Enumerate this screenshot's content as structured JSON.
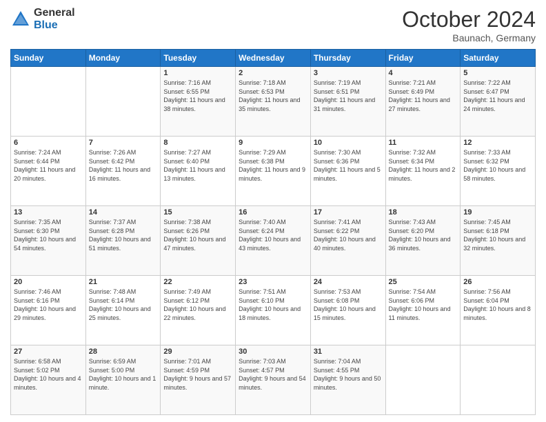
{
  "header": {
    "logo_general": "General",
    "logo_blue": "Blue",
    "month_title": "October 2024",
    "subtitle": "Baunach, Germany"
  },
  "weekdays": [
    "Sunday",
    "Monday",
    "Tuesday",
    "Wednesday",
    "Thursday",
    "Friday",
    "Saturday"
  ],
  "weeks": [
    [
      {
        "day": "",
        "sunrise": "",
        "sunset": "",
        "daylight": ""
      },
      {
        "day": "",
        "sunrise": "",
        "sunset": "",
        "daylight": ""
      },
      {
        "day": "1",
        "sunrise": "Sunrise: 7:16 AM",
        "sunset": "Sunset: 6:55 PM",
        "daylight": "Daylight: 11 hours and 38 minutes."
      },
      {
        "day": "2",
        "sunrise": "Sunrise: 7:18 AM",
        "sunset": "Sunset: 6:53 PM",
        "daylight": "Daylight: 11 hours and 35 minutes."
      },
      {
        "day": "3",
        "sunrise": "Sunrise: 7:19 AM",
        "sunset": "Sunset: 6:51 PM",
        "daylight": "Daylight: 11 hours and 31 minutes."
      },
      {
        "day": "4",
        "sunrise": "Sunrise: 7:21 AM",
        "sunset": "Sunset: 6:49 PM",
        "daylight": "Daylight: 11 hours and 27 minutes."
      },
      {
        "day": "5",
        "sunrise": "Sunrise: 7:22 AM",
        "sunset": "Sunset: 6:47 PM",
        "daylight": "Daylight: 11 hours and 24 minutes."
      }
    ],
    [
      {
        "day": "6",
        "sunrise": "Sunrise: 7:24 AM",
        "sunset": "Sunset: 6:44 PM",
        "daylight": "Daylight: 11 hours and 20 minutes."
      },
      {
        "day": "7",
        "sunrise": "Sunrise: 7:26 AM",
        "sunset": "Sunset: 6:42 PM",
        "daylight": "Daylight: 11 hours and 16 minutes."
      },
      {
        "day": "8",
        "sunrise": "Sunrise: 7:27 AM",
        "sunset": "Sunset: 6:40 PM",
        "daylight": "Daylight: 11 hours and 13 minutes."
      },
      {
        "day": "9",
        "sunrise": "Sunrise: 7:29 AM",
        "sunset": "Sunset: 6:38 PM",
        "daylight": "Daylight: 11 hours and 9 minutes."
      },
      {
        "day": "10",
        "sunrise": "Sunrise: 7:30 AM",
        "sunset": "Sunset: 6:36 PM",
        "daylight": "Daylight: 11 hours and 5 minutes."
      },
      {
        "day": "11",
        "sunrise": "Sunrise: 7:32 AM",
        "sunset": "Sunset: 6:34 PM",
        "daylight": "Daylight: 11 hours and 2 minutes."
      },
      {
        "day": "12",
        "sunrise": "Sunrise: 7:33 AM",
        "sunset": "Sunset: 6:32 PM",
        "daylight": "Daylight: 10 hours and 58 minutes."
      }
    ],
    [
      {
        "day": "13",
        "sunrise": "Sunrise: 7:35 AM",
        "sunset": "Sunset: 6:30 PM",
        "daylight": "Daylight: 10 hours and 54 minutes."
      },
      {
        "day": "14",
        "sunrise": "Sunrise: 7:37 AM",
        "sunset": "Sunset: 6:28 PM",
        "daylight": "Daylight: 10 hours and 51 minutes."
      },
      {
        "day": "15",
        "sunrise": "Sunrise: 7:38 AM",
        "sunset": "Sunset: 6:26 PM",
        "daylight": "Daylight: 10 hours and 47 minutes."
      },
      {
        "day": "16",
        "sunrise": "Sunrise: 7:40 AM",
        "sunset": "Sunset: 6:24 PM",
        "daylight": "Daylight: 10 hours and 43 minutes."
      },
      {
        "day": "17",
        "sunrise": "Sunrise: 7:41 AM",
        "sunset": "Sunset: 6:22 PM",
        "daylight": "Daylight: 10 hours and 40 minutes."
      },
      {
        "day": "18",
        "sunrise": "Sunrise: 7:43 AM",
        "sunset": "Sunset: 6:20 PM",
        "daylight": "Daylight: 10 hours and 36 minutes."
      },
      {
        "day": "19",
        "sunrise": "Sunrise: 7:45 AM",
        "sunset": "Sunset: 6:18 PM",
        "daylight": "Daylight: 10 hours and 32 minutes."
      }
    ],
    [
      {
        "day": "20",
        "sunrise": "Sunrise: 7:46 AM",
        "sunset": "Sunset: 6:16 PM",
        "daylight": "Daylight: 10 hours and 29 minutes."
      },
      {
        "day": "21",
        "sunrise": "Sunrise: 7:48 AM",
        "sunset": "Sunset: 6:14 PM",
        "daylight": "Daylight: 10 hours and 25 minutes."
      },
      {
        "day": "22",
        "sunrise": "Sunrise: 7:49 AM",
        "sunset": "Sunset: 6:12 PM",
        "daylight": "Daylight: 10 hours and 22 minutes."
      },
      {
        "day": "23",
        "sunrise": "Sunrise: 7:51 AM",
        "sunset": "Sunset: 6:10 PM",
        "daylight": "Daylight: 10 hours and 18 minutes."
      },
      {
        "day": "24",
        "sunrise": "Sunrise: 7:53 AM",
        "sunset": "Sunset: 6:08 PM",
        "daylight": "Daylight: 10 hours and 15 minutes."
      },
      {
        "day": "25",
        "sunrise": "Sunrise: 7:54 AM",
        "sunset": "Sunset: 6:06 PM",
        "daylight": "Daylight: 10 hours and 11 minutes."
      },
      {
        "day": "26",
        "sunrise": "Sunrise: 7:56 AM",
        "sunset": "Sunset: 6:04 PM",
        "daylight": "Daylight: 10 hours and 8 minutes."
      }
    ],
    [
      {
        "day": "27",
        "sunrise": "Sunrise: 6:58 AM",
        "sunset": "Sunset: 5:02 PM",
        "daylight": "Daylight: 10 hours and 4 minutes."
      },
      {
        "day": "28",
        "sunrise": "Sunrise: 6:59 AM",
        "sunset": "Sunset: 5:00 PM",
        "daylight": "Daylight: 10 hours and 1 minute."
      },
      {
        "day": "29",
        "sunrise": "Sunrise: 7:01 AM",
        "sunset": "Sunset: 4:59 PM",
        "daylight": "Daylight: 9 hours and 57 minutes."
      },
      {
        "day": "30",
        "sunrise": "Sunrise: 7:03 AM",
        "sunset": "Sunset: 4:57 PM",
        "daylight": "Daylight: 9 hours and 54 minutes."
      },
      {
        "day": "31",
        "sunrise": "Sunrise: 7:04 AM",
        "sunset": "Sunset: 4:55 PM",
        "daylight": "Daylight: 9 hours and 50 minutes."
      },
      {
        "day": "",
        "sunrise": "",
        "sunset": "",
        "daylight": ""
      },
      {
        "day": "",
        "sunrise": "",
        "sunset": "",
        "daylight": ""
      }
    ]
  ]
}
